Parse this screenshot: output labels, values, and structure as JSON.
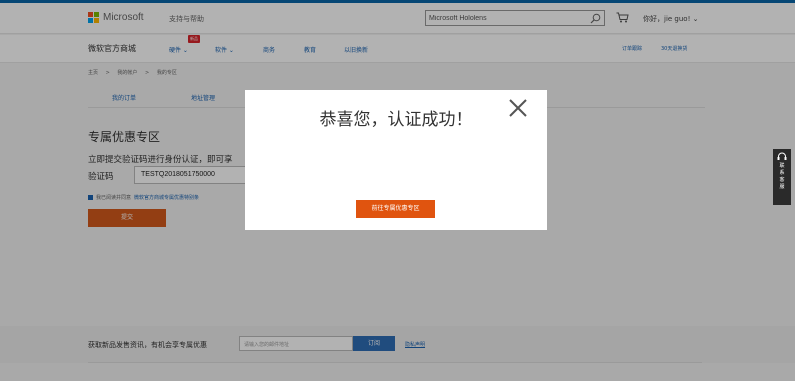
{
  "colors": {
    "accent_blue": "#1a62b0",
    "top_bar": "#0a66a8",
    "submit_orange": "#d35a1c",
    "modal_button_orange": "#e0540f",
    "badge_red": "#d9242b",
    "overlay": "rgba(0,0,0,0.30)"
  },
  "header": {
    "brand": "Microsoft",
    "support_link": "支持与帮助",
    "search_value": "Microsoft Hololens",
    "greeting": "你好，jie guo! ⌄",
    "icons": [
      "microsoft-logo",
      "search-icon",
      "cart-icon"
    ]
  },
  "nav": {
    "store_title": "微软官方商城",
    "badge": "新品",
    "items": [
      "硬件 ⌄",
      "软件 ⌄",
      "商务",
      "教育",
      "以旧换新"
    ],
    "right_items": [
      "订单跟踪",
      "30天退换货"
    ]
  },
  "breadcrumb": {
    "items": [
      "主页",
      ">",
      "我的帐户",
      ">",
      "我的专区"
    ]
  },
  "tabs": {
    "items": [
      "我的订单",
      "地址管理"
    ]
  },
  "main": {
    "section_title": "专属优惠专区",
    "description": "立即提交验证码进行身份认证，即可享",
    "code_label": "验证码",
    "code_value": "TESTQ2018051750000",
    "agree_text": "我已阅读并同意",
    "agree_link": "微软官方商城专属优惠特别条",
    "submit_label": "提交"
  },
  "newsletter": {
    "text": "获取新品发售资讯，有机会享专属优惠",
    "placeholder": "请输入您的邮件地址",
    "subscribe_label": "订阅",
    "privacy_link": "隐私声明"
  },
  "side_contact": {
    "chars": [
      "联",
      "系",
      "客",
      "服"
    ]
  },
  "modal": {
    "title": "恭喜您，认证成功！",
    "button_label": "前往专属优惠专区"
  }
}
